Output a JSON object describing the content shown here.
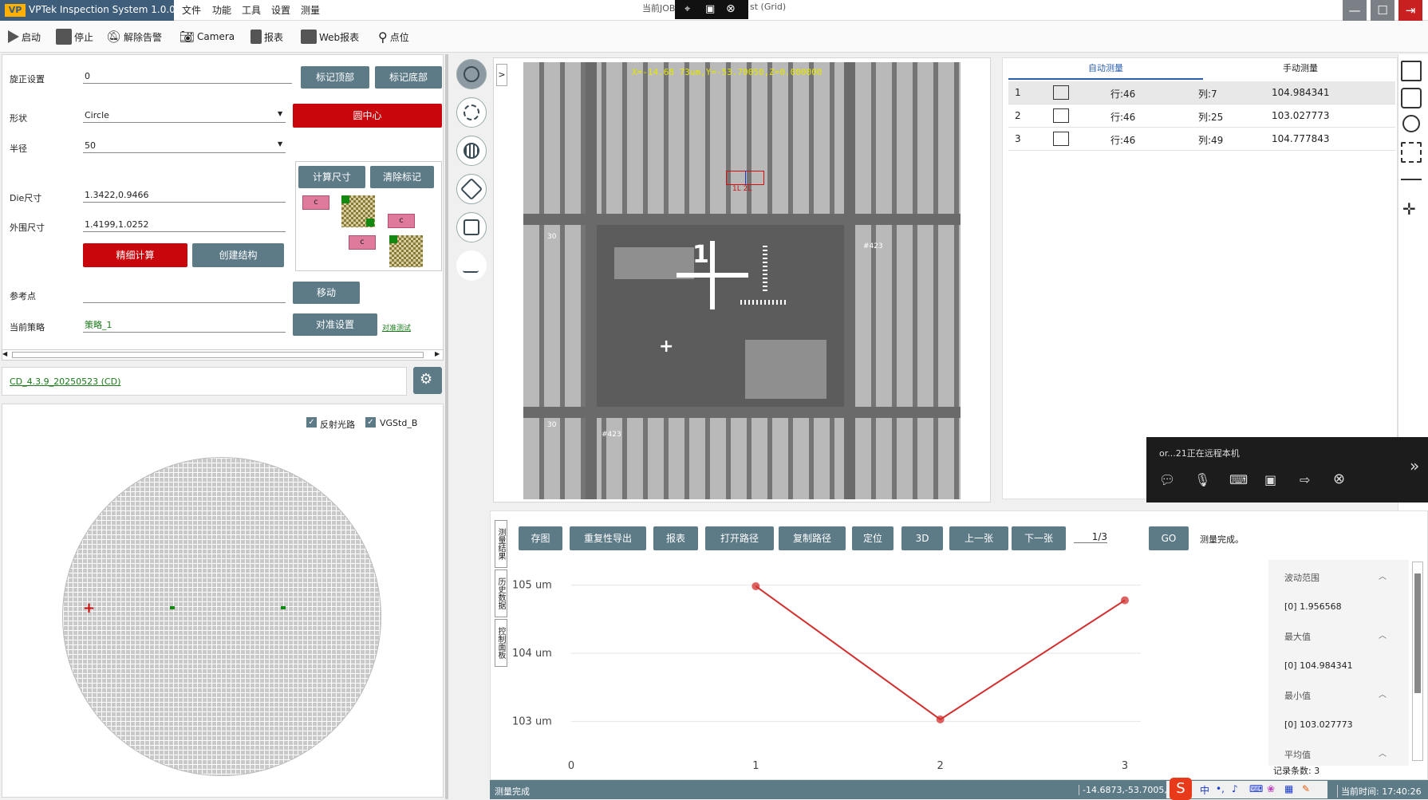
{
  "window": {
    "title": "VPTek Inspection System 1.0.0.0",
    "job_label": "当前JOB",
    "job_suffix": "st (Grid)",
    "menu": [
      "文件",
      "功能",
      "工具",
      "设置",
      "测量"
    ]
  },
  "toolbar": [
    {
      "label": "启动",
      "icon": "play-icon"
    },
    {
      "label": "停止",
      "icon": "stop-icon"
    },
    {
      "label": "解除告警",
      "icon": "bell-off-icon"
    },
    {
      "label": "Camera",
      "icon": "camera-icon"
    },
    {
      "label": "报表",
      "icon": "report-icon"
    },
    {
      "label": "Web报表",
      "icon": "web-report-icon"
    },
    {
      "label": "点位",
      "icon": "location-pin-icon"
    }
  ],
  "align_panel": {
    "rotate_label": "旋正设置",
    "rotate_value": "0",
    "btn_mark_top": "标记顶部",
    "btn_mark_bottom": "标记底部",
    "shape_label": "形状",
    "shape_value": "Circle",
    "btn_center": "圆中心",
    "radius_label": "半径",
    "radius_value": "50",
    "btn_calc_size": "计算尺寸",
    "btn_clear_mark": "清除标记",
    "die_label": "Die尺寸",
    "die_value": "1.3422,0.9466",
    "outer_label": "外围尺寸",
    "outer_value": "1.4199,1.0252",
    "btn_fine_calc": "精细计算",
    "btn_create_struct": "创建结构",
    "ref_label": "参考点",
    "ref_value": "",
    "btn_move": "移动",
    "strategy_label": "当前策略",
    "strategy_value": "策略_1",
    "btn_align_settings": "对准设置",
    "align_test_link": "对准测试",
    "chip_label": "c"
  },
  "recipe": {
    "link": "CD_4.3.9_20250523 (CD)"
  },
  "wafer": {
    "chk_reflect": "反射光路",
    "chk_vgstd": "VGStd_B"
  },
  "image_view": {
    "coord_text": "X=-14.68 73um,Y=-53.70050,Z=0.000000",
    "expand": ">",
    "roi_labels": "1L 2L",
    "die_label_1": "1",
    "marks": [
      "30",
      "30",
      "#423",
      "#423"
    ]
  },
  "meas_tabs": {
    "auto": "自动测量",
    "manual": "手动测量"
  },
  "meas_rows": [
    {
      "idx": "1",
      "row": "行:46",
      "col": "列:7",
      "value": "104.984341"
    },
    {
      "idx": "2",
      "row": "行:46",
      "col": "列:25",
      "value": "103.027773"
    },
    {
      "idx": "3",
      "row": "行:46",
      "col": "列:49",
      "value": "104.777843"
    }
  ],
  "remote": {
    "text": "or...21正在远程本机",
    "expand": "»"
  },
  "bottom_tabs": [
    "测量结果",
    "历史数据",
    "控制面板"
  ],
  "bottom_buttons": [
    "存图",
    "重复性导出",
    "报表",
    "打开路径",
    "复制路径",
    "定位",
    "3D",
    "上一张",
    "下一张"
  ],
  "pager": "1/3",
  "go_btn": "GO",
  "status_done": "测量完成。",
  "stats": [
    {
      "title": "波动范围",
      "value": "[0]  1.956568"
    },
    {
      "title": "最大值",
      "value": "[0]  104.984341"
    },
    {
      "title": "最小值",
      "value": "[0]  103.027773"
    },
    {
      "title": "平均值",
      "value": ""
    }
  ],
  "record_count": "记录条数: 3",
  "statusbar": {
    "left": "测量完成",
    "coords": "-14.6873,-53.7005,0.0",
    "time": "当前时间:  17:40:26"
  },
  "chart_data": {
    "type": "line",
    "x": [
      1,
      2,
      3
    ],
    "values": [
      104.984341,
      103.027773,
      104.777843
    ],
    "x_ticks": [
      "0",
      "1",
      "2",
      "3"
    ],
    "y_ticks": [
      "105 um",
      "104 um",
      "103 um"
    ],
    "xlim": [
      0,
      3
    ],
    "ylim": [
      102.7,
      105.3
    ],
    "color": "#d32f2f"
  }
}
